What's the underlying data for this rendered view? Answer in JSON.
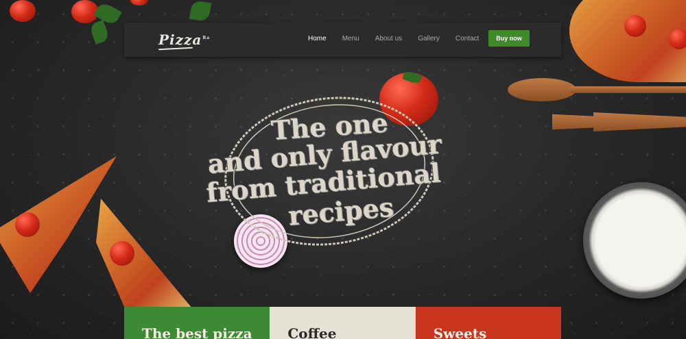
{
  "brand": {
    "logo_text": "Pizza",
    "logo_sup": "Ra"
  },
  "nav": {
    "items": [
      {
        "label": "Home",
        "active": true
      },
      {
        "label": "Menu",
        "active": false
      },
      {
        "label": "About us",
        "active": false
      },
      {
        "label": "Gallery",
        "active": false
      },
      {
        "label": "Contact",
        "active": false
      }
    ],
    "cta_label": "Buy now"
  },
  "hero": {
    "line1": "The one",
    "line2": "and only flavour",
    "line3": "from traditional",
    "line4": "recipes"
  },
  "bands": [
    {
      "label": "The best pizza",
      "color": "#3c8a33"
    },
    {
      "label": "Coffee",
      "color": "#e6e1d5"
    },
    {
      "label": "Sweets",
      "color": "#c9351f"
    }
  ],
  "colors": {
    "accent_green": "#3f8a2b",
    "navbar": "#2b2b2b",
    "background": "#2a2a2a"
  }
}
